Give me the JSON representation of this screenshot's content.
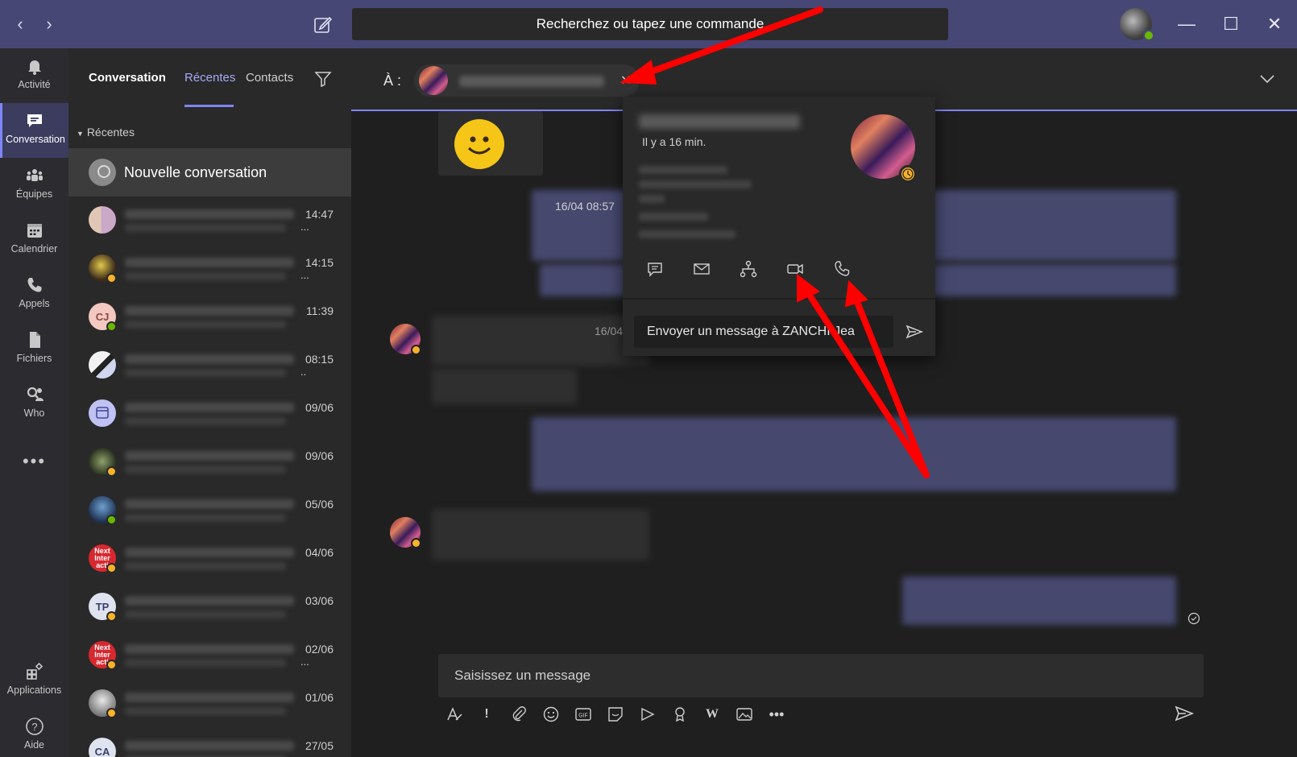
{
  "titlebar": {
    "search_text": "Recherchez ou tapez une commande",
    "back_icon": "chevron-left-icon",
    "forward_icon": "chevron-right-icon",
    "compose_icon": "compose-icon"
  },
  "rail": {
    "items": [
      {
        "label": "Activité",
        "icon": "bell-icon"
      },
      {
        "label": "Conversation",
        "icon": "chat-icon",
        "active": true
      },
      {
        "label": "Équipes",
        "icon": "teams-icon"
      },
      {
        "label": "Calendrier",
        "icon": "calendar-icon"
      },
      {
        "label": "Appels",
        "icon": "phone-icon"
      },
      {
        "label": "Fichiers",
        "icon": "file-icon"
      },
      {
        "label": "Who",
        "icon": "who-icon"
      }
    ],
    "more": "•••",
    "bottom": [
      {
        "label": "Applications",
        "icon": "apps-icon"
      },
      {
        "label": "Aide",
        "icon": "help-icon"
      }
    ]
  },
  "list": {
    "tabs": [
      "Conversation",
      "Récentes",
      "Contacts"
    ],
    "section": "Récentes",
    "new_conversation": "Nouvelle conversation",
    "rows": [
      {
        "time": "14:47",
        "ellipsis": "...",
        "status": "none"
      },
      {
        "time": "14:15",
        "ellipsis": "...",
        "status": "away"
      },
      {
        "time": "11:39",
        "ellipsis": "",
        "status": "ok",
        "initials": "CJ"
      },
      {
        "time": "08:15",
        "ellipsis": "..",
        "status": "none"
      },
      {
        "time": "09/06",
        "ellipsis": "",
        "status": "none"
      },
      {
        "time": "09/06",
        "ellipsis": "",
        "status": "away"
      },
      {
        "time": "05/06",
        "ellipsis": "",
        "status": "ok"
      },
      {
        "time": "04/06",
        "ellipsis": "",
        "status": "away",
        "logo": "Next Inter acti"
      },
      {
        "time": "03/06",
        "ellipsis": "",
        "status": "away",
        "initials": "TP"
      },
      {
        "time": "02/06",
        "ellipsis": "...",
        "status": "away",
        "logo": "Next Inter acti"
      },
      {
        "time": "01/06",
        "ellipsis": "",
        "status": "away"
      },
      {
        "time": "27/05",
        "ellipsis": "",
        "status": "none",
        "initials": "CA"
      }
    ]
  },
  "main": {
    "to_label": "À :",
    "msg_date_1": "16/04 08:57",
    "msg_date_2": "16/04",
    "compose_placeholder": "Saisissez un message",
    "toolbar": [
      "format-icon",
      "important-icon",
      "attach-icon",
      "emoji-icon",
      "gif-icon",
      "sticker-icon",
      "meet-icon",
      "praise-icon",
      "wiki-icon",
      "image-icon",
      "more-icon"
    ]
  },
  "card": {
    "last_seen": "Il y a 16 min.",
    "message_input": "Envoyer un message à ZANCHI Jea",
    "actions": [
      "chat-icon",
      "mail-icon",
      "org-chart-icon",
      "video-call-icon",
      "phone-call-icon"
    ]
  },
  "colors": {
    "titlebar": "#464775",
    "accent": "#7f85f5",
    "away": "#f8b32b",
    "available": "#6bb700",
    "annotation_arrow": "#ff0000"
  }
}
